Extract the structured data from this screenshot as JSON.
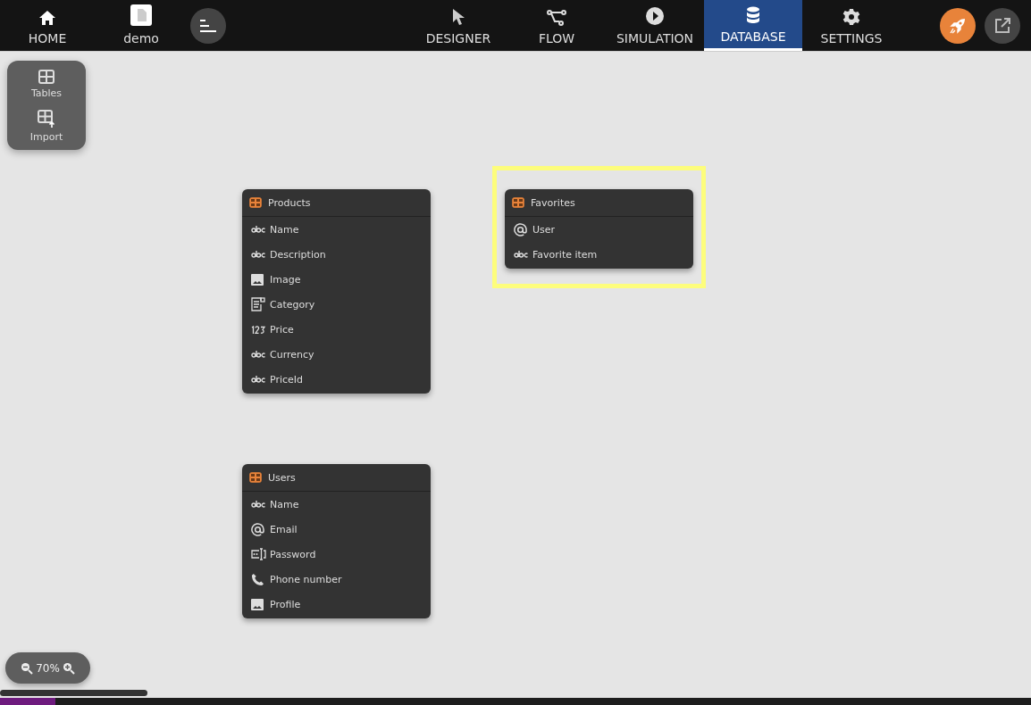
{
  "top_bar": {
    "home": {
      "label": "HOME"
    },
    "project": {
      "label": "demo"
    },
    "tabs": [
      {
        "label": "DESIGNER",
        "kind": "designer",
        "selected": false
      },
      {
        "label": "FLOW",
        "kind": "flow",
        "selected": false
      },
      {
        "label": "SIMULATION",
        "kind": "simulation",
        "selected": false
      },
      {
        "label": "DATABASE",
        "kind": "database",
        "selected": true
      },
      {
        "label": "SETTINGS",
        "kind": "settings",
        "selected": false
      }
    ]
  },
  "side_panel": {
    "items": [
      {
        "label": "Tables",
        "kind": "tables"
      },
      {
        "label": "Import",
        "kind": "import"
      }
    ]
  },
  "tables": [
    {
      "name": "Products",
      "selected": false,
      "fields": [
        {
          "name": "Name",
          "kind": "text"
        },
        {
          "name": "Description",
          "kind": "text"
        },
        {
          "name": "Image",
          "kind": "image"
        },
        {
          "name": "Category",
          "kind": "choice"
        },
        {
          "name": "Price",
          "kind": "number"
        },
        {
          "name": "Currency",
          "kind": "text"
        },
        {
          "name": "PriceId",
          "kind": "text"
        }
      ]
    },
    {
      "name": "Favorites",
      "selected": true,
      "fields": [
        {
          "name": "User",
          "kind": "email"
        },
        {
          "name": "Favorite item",
          "kind": "text"
        }
      ]
    },
    {
      "name": "Users",
      "selected": false,
      "fields": [
        {
          "name": "Name",
          "kind": "text"
        },
        {
          "name": "Email",
          "kind": "email"
        },
        {
          "name": "Password",
          "kind": "password"
        },
        {
          "name": "Phone number",
          "kind": "phone"
        },
        {
          "name": "Profile",
          "kind": "image"
        }
      ]
    }
  ],
  "zoom": {
    "reading": "70%"
  }
}
